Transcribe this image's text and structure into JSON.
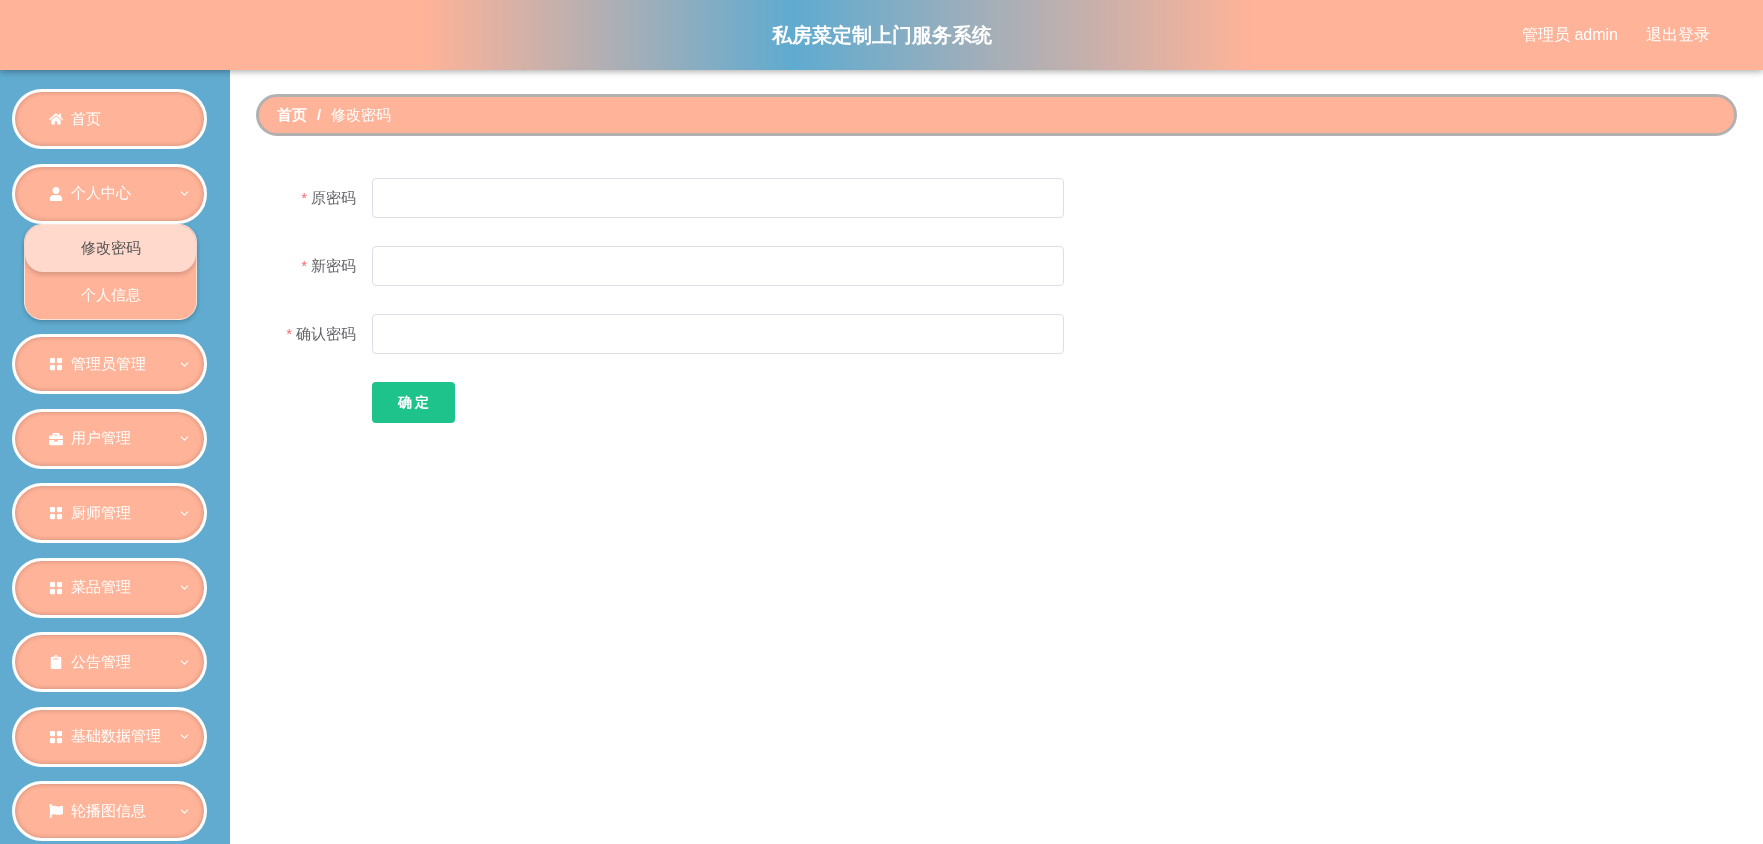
{
  "header": {
    "title": "私房菜定制上门服务系统",
    "user": "管理员 admin",
    "logout": "退出登录"
  },
  "sidebar": {
    "items": [
      {
        "label": "首页",
        "kind": "link"
      },
      {
        "label": "个人中心",
        "kind": "submenu",
        "expanded": true,
        "children": [
          {
            "label": "修改密码",
            "selected": true
          },
          {
            "label": "个人信息",
            "selected": false
          }
        ]
      },
      {
        "label": "管理员管理",
        "kind": "submenu"
      },
      {
        "label": "用户管理",
        "kind": "submenu"
      },
      {
        "label": "厨师管理",
        "kind": "submenu"
      },
      {
        "label": "菜品管理",
        "kind": "submenu"
      },
      {
        "label": "公告管理",
        "kind": "submenu"
      },
      {
        "label": "基础数据管理",
        "kind": "submenu"
      },
      {
        "label": "轮播图信息",
        "kind": "submenu"
      }
    ]
  },
  "breadcrumb": {
    "items": [
      "首页",
      "修改密码"
    ],
    "separator": "/"
  },
  "form": {
    "fields": [
      {
        "mark": "*",
        "label": "原密码"
      },
      {
        "mark": "*",
        "label": "新密码"
      },
      {
        "mark": "*",
        "label": "确认密码"
      }
    ],
    "submit": "确 定"
  }
}
